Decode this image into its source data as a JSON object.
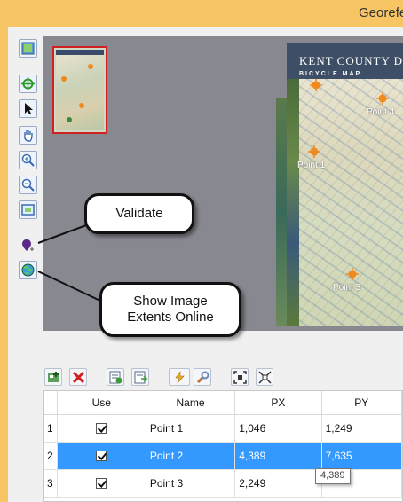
{
  "window": {
    "title": "Georefe"
  },
  "map": {
    "title": "KENT COUNTY DEL",
    "subtitle": "BICYCLE MAP",
    "points": [
      "Point 4",
      "Point 1",
      "Point 3"
    ]
  },
  "callouts": {
    "validate": "Validate",
    "show_extents_line1": "Show Image",
    "show_extents_line2": "Extents Online"
  },
  "table": {
    "headers": [
      "Use",
      "Name",
      "PX",
      "PY"
    ],
    "rows": [
      {
        "num": "1",
        "use": true,
        "name": "Point 1",
        "px": "1,046",
        "py": "1,249"
      },
      {
        "num": "2",
        "use": true,
        "name": "Point 2",
        "px": "4,389",
        "py": "7,635"
      },
      {
        "num": "3",
        "use": true,
        "name": "Point 3",
        "px": "2,249",
        "py": ""
      }
    ],
    "selected_row": 2
  },
  "tooltip": "4,389",
  "icons": {
    "left_toolbar": [
      "layer-icon",
      "crosshair-icon",
      "pointer-icon",
      "pan-hand-icon",
      "zoom-in-icon",
      "zoom-out-icon",
      "zoom-extent-icon",
      "validate-pin-icon",
      "globe-icon"
    ],
    "bottom_toolbar": [
      "add-point-icon",
      "delete-icon",
      "import-icon",
      "export-icon",
      "auto-icon",
      "settings-icon",
      "fit-icon",
      "full-extent-icon"
    ]
  },
  "colors": {
    "selection": "#3399ff",
    "titlebar": "#f7c563",
    "thumb_border": "#d02020"
  }
}
